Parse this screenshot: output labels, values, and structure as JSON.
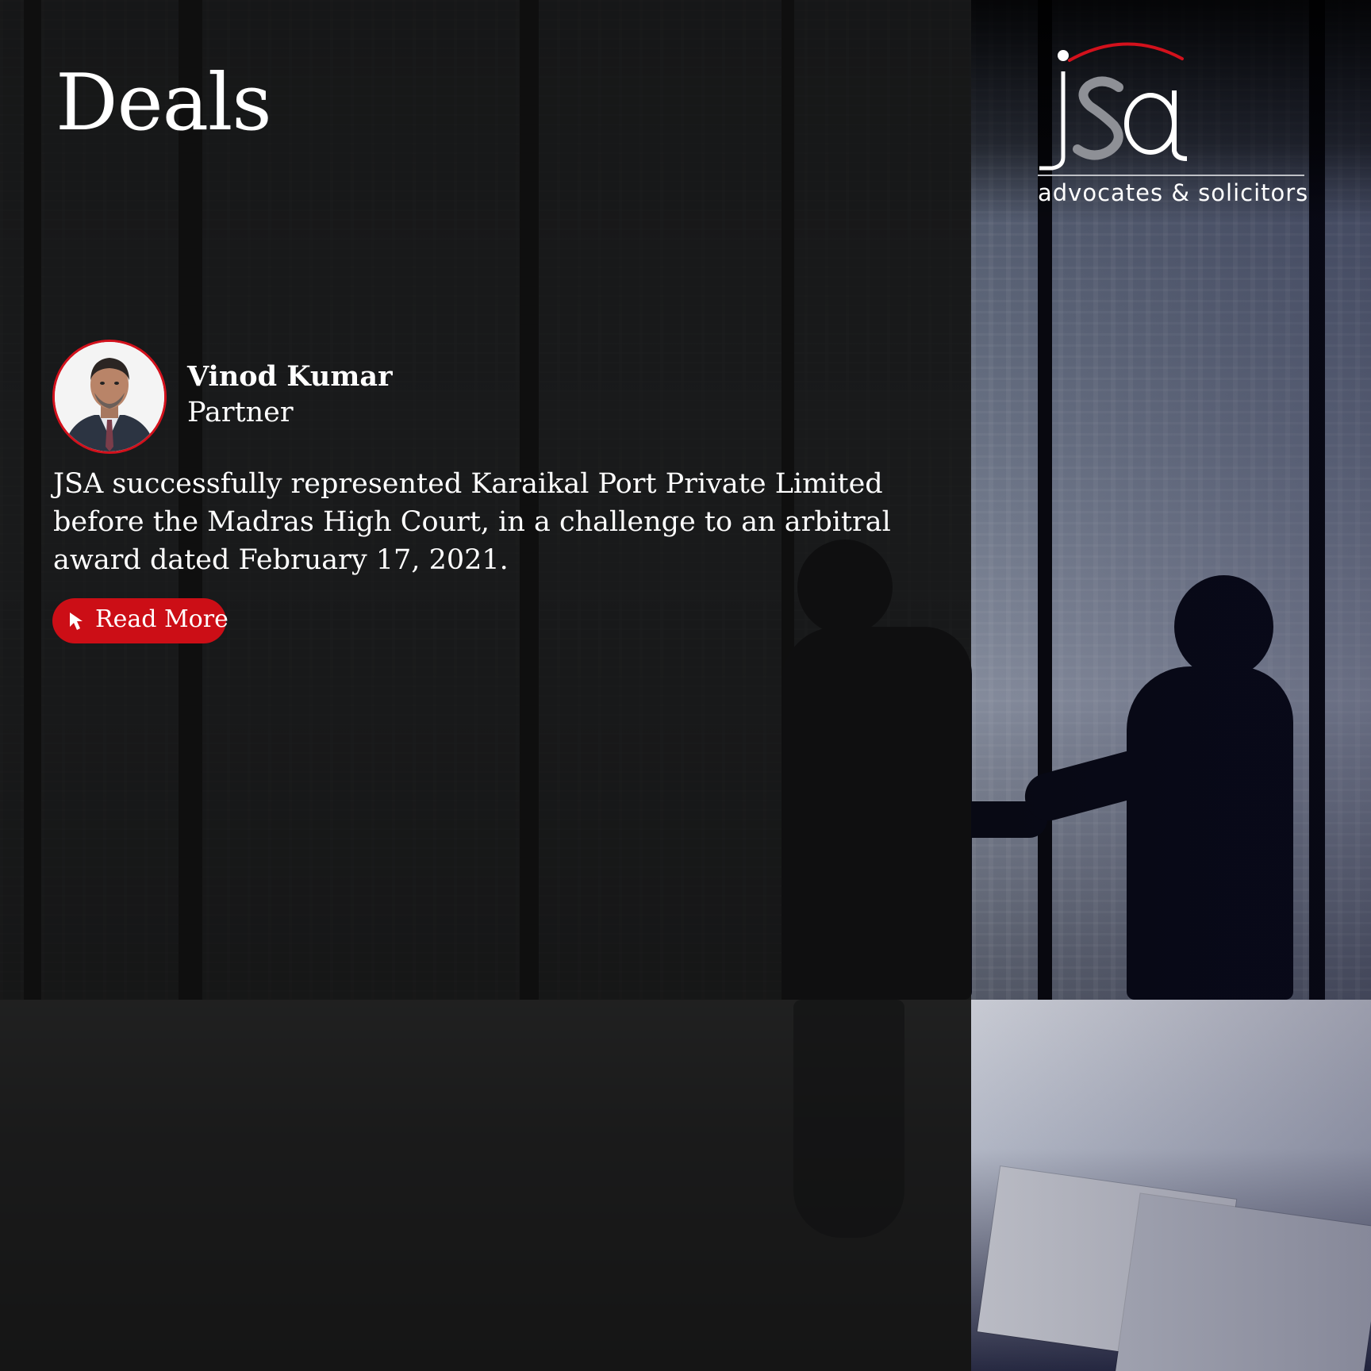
{
  "header": {
    "title": "Deals"
  },
  "brand": {
    "logo_text": "jsa",
    "tagline": "advocates & solicitors",
    "accent_color": "#d3111c"
  },
  "author": {
    "name": "Vinod Kumar",
    "role": "Partner"
  },
  "article": {
    "summary": "JSA successfully represented Karaikal Port Private Limited before the Madras High Court, in a challenge to an arbitral award dated February 17, 2021."
  },
  "cta": {
    "label": "Read More",
    "icon": "cursor-arrow-icon",
    "color": "#cc0e16"
  },
  "background": {
    "scene": "business-handshake-office-photo"
  }
}
